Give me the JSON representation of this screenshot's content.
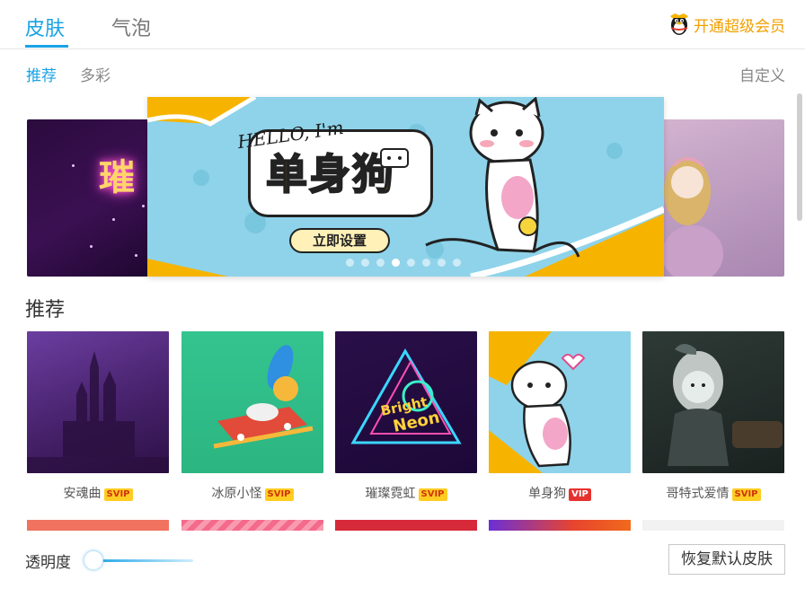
{
  "top_tabs": [
    {
      "label": "皮肤"
    },
    {
      "label": "气泡"
    }
  ],
  "vip_link": {
    "label": "开通超级会员",
    "icon": "qq-penguin-icon",
    "color": "#f0a000"
  },
  "sub_tabs": [
    {
      "label": "推荐"
    },
    {
      "label": "多彩"
    }
  ],
  "custom_link": "自定义",
  "carousel": {
    "hello_text": "HELLO, I'm",
    "title": "单身狗",
    "button_label": "立即设置",
    "left_preview_text": "璀",
    "dots_count": 8,
    "active_dot": 3
  },
  "section": {
    "title": "推荐"
  },
  "skins": [
    {
      "name": "安魂曲",
      "badge": "SVIP"
    },
    {
      "name": "冰原小怪",
      "badge": "SVIP"
    },
    {
      "name": "璀璨霓虹",
      "badge": "SVIP",
      "thumb_text_1": "Bright",
      "thumb_text_2": "Neon"
    },
    {
      "name": "单身狗",
      "badge": "VIP"
    },
    {
      "name": "哥特式爱情",
      "badge": "SVIP"
    }
  ],
  "bottom": {
    "opacity_label": "透明度",
    "opacity_value": 0.0,
    "reset_label": "恢复默认皮肤"
  },
  "colors": {
    "accent": "#1aa3e6",
    "vip_gold": "#f0a000",
    "svip_badge": "#ffcc22",
    "vip_badge": "#e6322f"
  }
}
